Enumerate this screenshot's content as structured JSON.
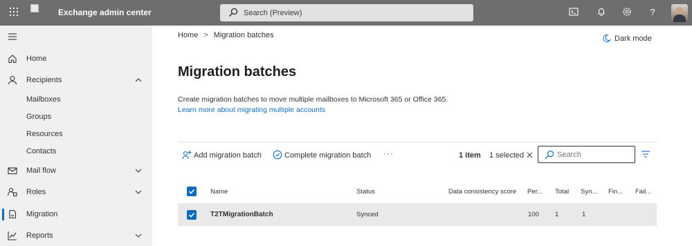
{
  "topbar": {
    "app_title": "Exchange admin center",
    "search_placeholder": "Search (Preview)",
    "icons": [
      "waffle-icon",
      "terminal-icon",
      "bell-icon",
      "gear-icon",
      "help-icon"
    ],
    "help_glyph": "?"
  },
  "nav": {
    "items": [
      {
        "label": "Home",
        "icon": "home-icon"
      },
      {
        "label": "Recipients",
        "icon": "person-icon",
        "expanded": true
      },
      {
        "label": "Mail flow",
        "icon": "mail-icon"
      },
      {
        "label": "Roles",
        "icon": "roles-icon"
      },
      {
        "label": "Migration",
        "icon": "migration-icon",
        "active": true
      },
      {
        "label": "Reports",
        "icon": "chart-icon"
      }
    ],
    "recipients_children": [
      "Mailboxes",
      "Groups",
      "Resources",
      "Contacts"
    ]
  },
  "breadcrumb": {
    "home": "Home",
    "current": "Migration batches",
    "separator": ">"
  },
  "dark_mode_label": "Dark mode",
  "page": {
    "title": "Migration batches",
    "description": "Create migration batches to move multiple mailboxes to Microsoft 365 or Office 365.",
    "learn_more": "Learn more about migrating multiple accounts"
  },
  "commands": {
    "add": "Add migration batch",
    "complete": "Complete migration batch",
    "more": "···",
    "items_count": "1 item",
    "selected_count": "1 selected",
    "clear_glyph": "✕",
    "search_placeholder": "Search"
  },
  "table": {
    "columns": [
      "Name",
      "Status",
      "Data consistency score",
      "Per...",
      "Total",
      "Syn...",
      "Fin...",
      "Fail..."
    ],
    "rows": [
      {
        "name": "T2TMigrationBatch",
        "status": "Synced",
        "data_consistency_score": "",
        "per": "100",
        "total": "1",
        "synced": "1",
        "finalized": "",
        "failed": "",
        "selected": true
      }
    ]
  },
  "colors": {
    "accent": "#0f6cbd",
    "topbar": "#6e6e6e",
    "nav_bg": "#f0f0f0",
    "row_selected": "#e9e9e9"
  }
}
